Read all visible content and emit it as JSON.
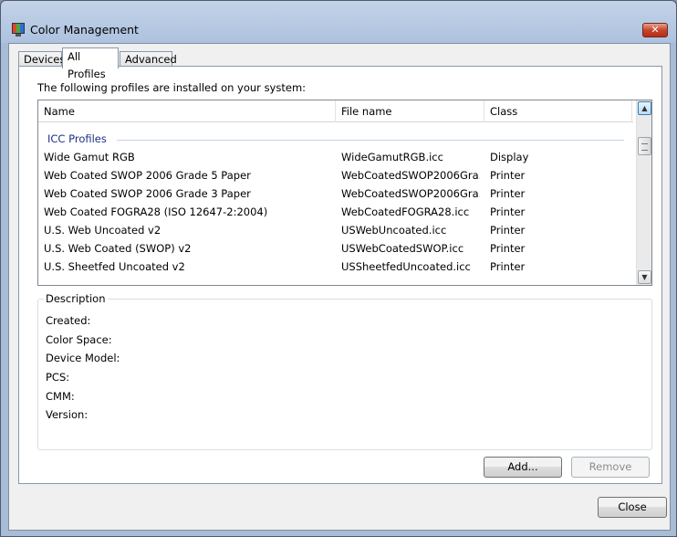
{
  "window": {
    "title": "Color Management"
  },
  "tabs": [
    {
      "label": "Devices"
    },
    {
      "label": "All Profiles"
    },
    {
      "label": "Advanced"
    }
  ],
  "intro_text": "The following profiles are installed on your system:",
  "list": {
    "columns": [
      "Name",
      "File name",
      "Class"
    ],
    "group_header": "ICC Profiles",
    "rows": [
      {
        "name": "Wide Gamut RGB",
        "file": "WideGamutRGB.icc",
        "class": "Display"
      },
      {
        "name": "Web Coated SWOP 2006 Grade 5 Paper",
        "file": "WebCoatedSWOP2006Gra...",
        "class": "Printer"
      },
      {
        "name": "Web Coated SWOP 2006 Grade 3 Paper",
        "file": "WebCoatedSWOP2006Gra...",
        "class": "Printer"
      },
      {
        "name": "Web Coated FOGRA28 (ISO 12647-2:2004)",
        "file": "WebCoatedFOGRA28.icc",
        "class": "Printer"
      },
      {
        "name": "U.S. Web Uncoated v2",
        "file": "USWebUncoated.icc",
        "class": "Printer"
      },
      {
        "name": "U.S. Web Coated (SWOP) v2",
        "file": "USWebCoatedSWOP.icc",
        "class": "Printer"
      },
      {
        "name": "U.S. Sheetfed Uncoated v2",
        "file": "USSheetfedUncoated.icc",
        "class": "Printer"
      }
    ]
  },
  "description": {
    "title": "Description",
    "labels": [
      "Created:",
      "Color Space:",
      "Device Model:",
      "PCS:",
      "CMM:",
      "Version:"
    ]
  },
  "buttons": {
    "add": "Add...",
    "remove": "Remove",
    "close": "Close"
  },
  "icons": {
    "app": "color-management-icon",
    "close": "close-icon"
  }
}
